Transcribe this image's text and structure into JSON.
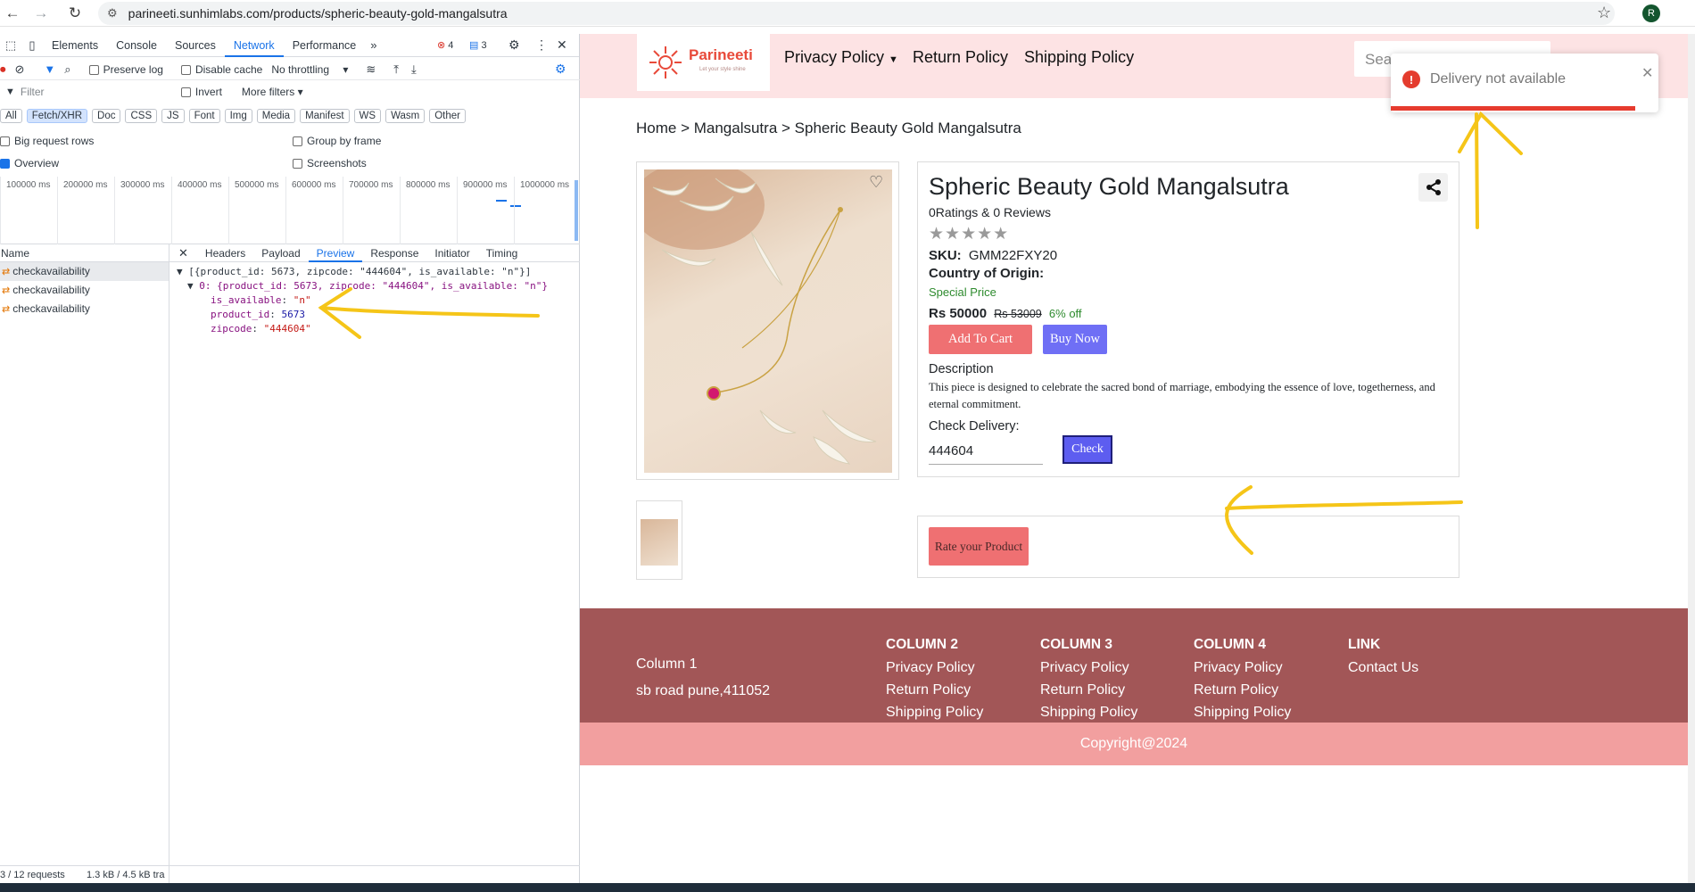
{
  "browser": {
    "url": "parineeti.sunhimlabs.com/products/spheric-beauty-gold-mangalsutra",
    "profile_initial": "R"
  },
  "devtools": {
    "tabs": [
      "Elements",
      "Console",
      "Sources",
      "Network",
      "Performance"
    ],
    "active_tab": "Network",
    "error_count": "4",
    "message_count": "3",
    "toolbar": {
      "preserve_log": "Preserve log",
      "disable_cache": "Disable cache",
      "throttling": "No throttling"
    },
    "filter": {
      "placeholder": "Filter",
      "invert": "Invert",
      "more_filters": "More filters"
    },
    "type_filters": [
      "All",
      "Fetch/XHR",
      "Doc",
      "CSS",
      "JS",
      "Font",
      "Img",
      "Media",
      "Manifest",
      "WS",
      "Wasm",
      "Other"
    ],
    "active_type": "Fetch/XHR",
    "options": {
      "big_request_rows": "Big request rows",
      "group_by_frame": "Group by frame",
      "overview": "Overview",
      "screenshots": "Screenshots"
    },
    "timeline_ticks": [
      "100000 ms",
      "200000 ms",
      "300000 ms",
      "400000 ms",
      "500000 ms",
      "600000 ms",
      "700000 ms",
      "800000 ms",
      "900000 ms",
      "1000000 ms"
    ],
    "name_header": "Name",
    "requests": [
      "checkavailability",
      "checkavailability",
      "checkavailability"
    ],
    "detail_tabs": [
      "Headers",
      "Payload",
      "Preview",
      "Response",
      "Initiator",
      "Timing"
    ],
    "active_detail_tab": "Preview",
    "preview": {
      "line1": "[{product_id: 5673, zipcode: \"444604\", is_available: \"n\"}]",
      "line2": "0: {product_id: 5673, zipcode: \"444604\", is_available: \"n\"}",
      "is_available_key": "is_available",
      "is_available_val": "\"n\"",
      "product_id_key": "product_id",
      "product_id_val": "5673",
      "zipcode_key": "zipcode",
      "zipcode_val": "\"444604\""
    },
    "status_requests": "3 / 12 requests",
    "status_transfer": "1.3 kB / 4.5 kB tra"
  },
  "site": {
    "logo_name": "Parineeti",
    "logo_tagline": "Let your style shine",
    "nav": [
      "Privacy Policy",
      "Return Policy",
      "Shipping Policy"
    ],
    "search_placeholder": "Sea",
    "toast_message": "Delivery not available",
    "breadcrumb": "Home > Mangalsutra > Spheric Beauty Gold Mangalsutra",
    "product": {
      "title": "Spheric Beauty Gold Mangalsutra",
      "ratings": "0Ratings & 0 Reviews",
      "stars": "★★★★★",
      "sku_label": "SKU:",
      "sku": "GMM22FXY20",
      "origin_label": "Country of Origin:",
      "special": "Special Price",
      "price": "Rs 50000",
      "mrp": "Rs 53009",
      "discount": "6% off",
      "add_to_cart": "Add To Cart",
      "buy_now": "Buy Now",
      "description_heading": "Description",
      "description": "This piece is designed to celebrate the sacred bond of marriage, embodying the essence of love, togetherness, and eternal commitment.",
      "check_delivery_label": "Check Delivery:",
      "zipcode": "444604",
      "check_button": "Check"
    },
    "rate_button": "Rate your Product",
    "footer": {
      "col1_title": "Column 1",
      "col1_address": "sb road pune,411052",
      "col2_title": "COLUMN 2",
      "col3_title": "COLUMN 3",
      "col4_title": "COLUMN 4",
      "link_title": "LINK",
      "links": [
        "Privacy Policy",
        "Return Policy",
        "Shipping Policy"
      ],
      "contact": "Contact Us",
      "copyright": "Copyright@2024"
    },
    "colors": {
      "header_bg": "#fde3e4",
      "footer_bg": "#a25657",
      "copyright_bg": "#f29f9f",
      "add_to_cart": "#ef7072",
      "buy_now": "#6f6ff5",
      "toast_error": "#e63b2e",
      "annotation": "#f5c518"
    }
  }
}
